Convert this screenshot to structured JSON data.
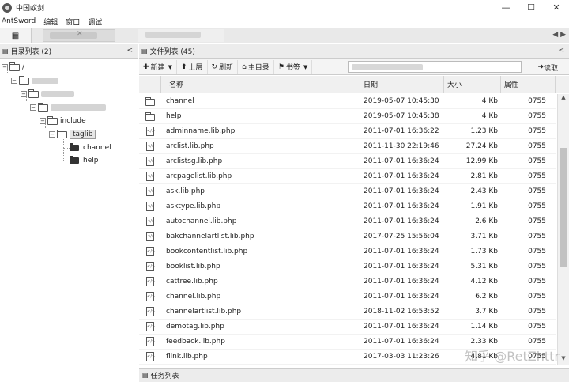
{
  "window": {
    "title": "中国蚁剑",
    "minimize": "—",
    "maximize": "☐",
    "close": "✕"
  },
  "menu": [
    "AntSword",
    "编辑",
    "窗口",
    "调试"
  ],
  "tabs": {
    "home_icon": "grid-icon",
    "close_glyph": "✕",
    "arrows": "◀ ▶"
  },
  "left_panel": {
    "title": "目录列表 (2)",
    "collapse": "<",
    "tree": [
      {
        "label": "/",
        "depth": 0,
        "blurred": false
      },
      {
        "label": "",
        "depth": 1,
        "blurred": true
      },
      {
        "label": "",
        "depth": 2,
        "blurred": true
      },
      {
        "label": "",
        "depth": 3,
        "blurred": true
      },
      {
        "label": "include",
        "depth": 4,
        "blurred": false
      },
      {
        "label": "taglib",
        "depth": 5,
        "blurred": false,
        "selected": true
      },
      {
        "label": "channel",
        "depth": 6,
        "blurred": false,
        "leaf": true
      },
      {
        "label": "help",
        "depth": 6,
        "blurred": false,
        "leaf": true
      }
    ]
  },
  "right_panel": {
    "title": "文件列表 (45)",
    "collapse": "<",
    "toolbar": {
      "new": "新建",
      "up": "上层",
      "refresh": "刷新",
      "home": "主目录",
      "bookmark": "书签",
      "read": "读取"
    },
    "columns": {
      "name": "名称",
      "date": "日期",
      "size": "大小",
      "attr": "属性"
    },
    "files": [
      {
        "type": "folder",
        "name": "channel",
        "date": "2019-05-07 10:45:30",
        "size": "4 Kb",
        "attr": "0755"
      },
      {
        "type": "folder",
        "name": "help",
        "date": "2019-05-07 10:45:38",
        "size": "4 Kb",
        "attr": "0755"
      },
      {
        "type": "file",
        "name": "adminname.lib.php",
        "date": "2011-07-01 16:36:22",
        "size": "1.23 Kb",
        "attr": "0755"
      },
      {
        "type": "file",
        "name": "arclist.lib.php",
        "date": "2011-11-30 22:19:46",
        "size": "27.24 Kb",
        "attr": "0755"
      },
      {
        "type": "file",
        "name": "arclistsg.lib.php",
        "date": "2011-07-01 16:36:24",
        "size": "12.99 Kb",
        "attr": "0755"
      },
      {
        "type": "file",
        "name": "arcpagelist.lib.php",
        "date": "2011-07-01 16:36:24",
        "size": "2.81 Kb",
        "attr": "0755"
      },
      {
        "type": "file",
        "name": "ask.lib.php",
        "date": "2011-07-01 16:36:24",
        "size": "2.43 Kb",
        "attr": "0755"
      },
      {
        "type": "file",
        "name": "asktype.lib.php",
        "date": "2011-07-01 16:36:24",
        "size": "1.91 Kb",
        "attr": "0755"
      },
      {
        "type": "file",
        "name": "autochannel.lib.php",
        "date": "2011-07-01 16:36:24",
        "size": "2.6 Kb",
        "attr": "0755"
      },
      {
        "type": "file",
        "name": "bakchannelartlist.lib.php",
        "date": "2017-07-25 15:56:04",
        "size": "3.71 Kb",
        "attr": "0755"
      },
      {
        "type": "file",
        "name": "bookcontentlist.lib.php",
        "date": "2011-07-01 16:36:24",
        "size": "1.73 Kb",
        "attr": "0755"
      },
      {
        "type": "file",
        "name": "booklist.lib.php",
        "date": "2011-07-01 16:36:24",
        "size": "5.31 Kb",
        "attr": "0755"
      },
      {
        "type": "file",
        "name": "cattree.lib.php",
        "date": "2011-07-01 16:36:24",
        "size": "4.12 Kb",
        "attr": "0755"
      },
      {
        "type": "file",
        "name": "channel.lib.php",
        "date": "2011-07-01 16:36:24",
        "size": "6.2 Kb",
        "attr": "0755"
      },
      {
        "type": "file",
        "name": "channelartlist.lib.php",
        "date": "2018-11-02 16:53:52",
        "size": "3.7 Kb",
        "attr": "0755"
      },
      {
        "type": "file",
        "name": "demotag.lib.php",
        "date": "2011-07-01 16:36:24",
        "size": "1.14 Kb",
        "attr": "0755"
      },
      {
        "type": "file",
        "name": "feedback.lib.php",
        "date": "2011-07-01 16:36:24",
        "size": "2.33 Kb",
        "attr": "0755"
      },
      {
        "type": "file",
        "name": "flink.lib.php",
        "date": "2017-03-03 11:23:26",
        "size": "4.81 Kb",
        "attr": "0755"
      }
    ]
  },
  "task_panel": {
    "title": "任务列表"
  },
  "watermark": "知乎 @RetZhttr"
}
